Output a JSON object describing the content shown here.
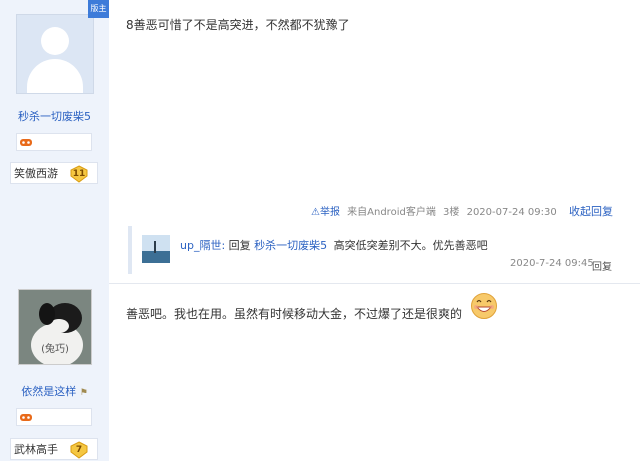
{
  "user1": {
    "name": "秒杀一切废柴5",
    "rank": "笑傲西游",
    "level": "11",
    "corner": "版主"
  },
  "user2": {
    "name": "依然是这样",
    "rank": "武林高手",
    "level": "7",
    "avatar_caption": "(兔巧)"
  },
  "post1": {
    "text": "8善恶可惜了不是高突进，不然都不犹豫了",
    "report": "举报",
    "source": "来自Android客户端",
    "floor": "3楼",
    "time": "2020-07-24 09:30",
    "collapse": "收起回复"
  },
  "reply": {
    "user": "up_隔世:",
    "reply_word": "回复",
    "target": "秒杀一切废柴5",
    "text": "高突低突差别不大。优先善恶吧",
    "time": "2020-7-24 09:45",
    "reply_btn": "回复"
  },
  "post2": {
    "text": "善恶吧。我也在用。虽然有时候移动大金，不过爆了还是很爽的"
  },
  "colors": {
    "link": "#2c62c2",
    "sidebar": "#eef3fb",
    "accent": "#3d7bd9"
  }
}
